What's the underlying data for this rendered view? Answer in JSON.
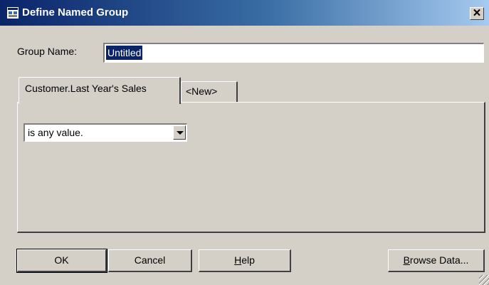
{
  "window": {
    "title": "Define Named Group",
    "close_label": "✕"
  },
  "group_name": {
    "label": "Group Name:",
    "value": "Untitled"
  },
  "tabs": [
    {
      "label": "Customer.Last Year's Sales",
      "active": true
    },
    {
      "label": "<New>",
      "active": false
    }
  ],
  "condition": {
    "selected": "is any value."
  },
  "buttons": {
    "ok": "OK",
    "cancel": "Cancel",
    "help_prefix": "H",
    "help_rest": "elp",
    "browse_prefix": "B",
    "browse_rest": "rowse Data..."
  },
  "colors": {
    "title_start": "#0a246a",
    "title_end": "#a6caf0",
    "face": "#d4d0c8",
    "selection": "#0a246a"
  },
  "icons": {
    "app": "app-window-icon",
    "close": "close-icon",
    "dropdown": "chevron-down-icon"
  }
}
